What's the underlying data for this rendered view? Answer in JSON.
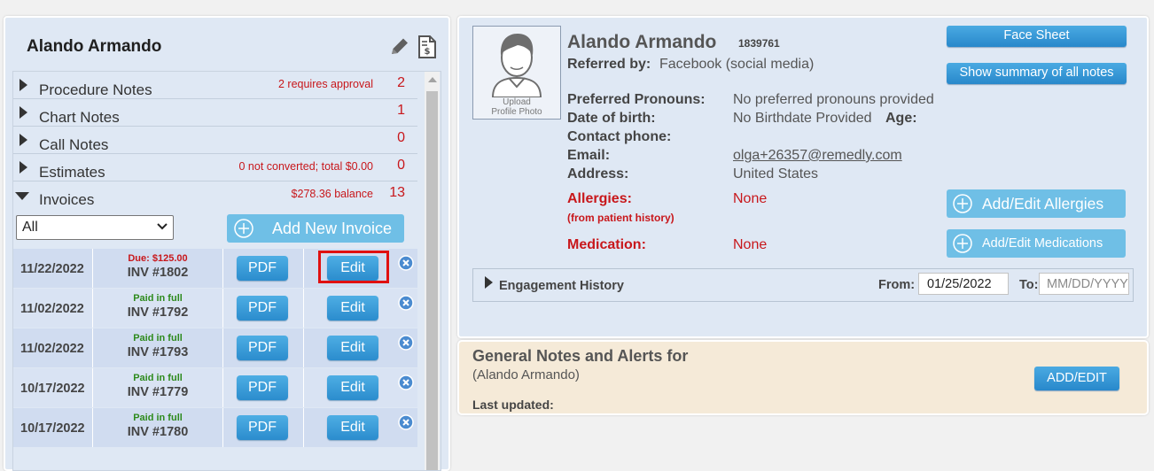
{
  "left": {
    "patient_name": "Alando Armando",
    "sections": [
      {
        "label": "Procedure Notes",
        "note": "2 requires approval",
        "count": "2"
      },
      {
        "label": "Chart Notes",
        "note": "",
        "count": "1"
      },
      {
        "label": "Call Notes",
        "note": "",
        "count": "0"
      },
      {
        "label": "Estimates",
        "note": "0 not converted; total $0.00",
        "count": "0"
      },
      {
        "label": "Invoices",
        "note": "$278.36 balance",
        "count": "13"
      }
    ],
    "filter": {
      "selected": "All"
    },
    "add_invoice_label": "Add New Invoice",
    "invoices": [
      {
        "date": "11/22/2022",
        "status": "Due: $125.00",
        "status_type": "due",
        "number": "INV #1802",
        "pdf_label": "PDF",
        "edit_label": "Edit"
      },
      {
        "date": "11/02/2022",
        "status": "Paid in full",
        "status_type": "paid",
        "number": "INV #1792",
        "pdf_label": "PDF",
        "edit_label": "Edit"
      },
      {
        "date": "11/02/2022",
        "status": "Paid in full",
        "status_type": "paid",
        "number": "INV #1793",
        "pdf_label": "PDF",
        "edit_label": "Edit"
      },
      {
        "date": "10/17/2022",
        "status": "Paid in full",
        "status_type": "paid",
        "number": "INV #1779",
        "pdf_label": "PDF",
        "edit_label": "Edit"
      },
      {
        "date": "10/17/2022",
        "status": "Paid in full",
        "status_type": "paid",
        "number": "INV #1780",
        "pdf_label": "PDF",
        "edit_label": "Edit"
      }
    ]
  },
  "profile": {
    "photo_caption_1": "Upload",
    "photo_caption_2": "Profile Photo",
    "name": "Alando Armando",
    "id": "1839761",
    "referred_label": "Referred by:",
    "referred_value": "Facebook (social media)",
    "pronouns_label": "Preferred Pronouns:",
    "pronouns_value": "No preferred pronouns provided",
    "dob_label": "Date of birth:",
    "dob_value": "No Birthdate Provided",
    "age_label": "Age:",
    "phone_label": "Contact phone:",
    "email_label": "Email:",
    "email_value": "olga+26357@remedly.com",
    "address_label": "Address:",
    "address_value": "United States",
    "allergies_label": "Allergies:",
    "allergies_sub": "(from patient history)",
    "allergies_value": "None",
    "medication_label": "Medication:",
    "medication_value": "None",
    "face_sheet_label": "Face Sheet",
    "summary_label": "Show summary of all notes",
    "add_allergies_label": "Add/Edit Allergies",
    "add_medications_label": "Add/Edit Medications",
    "engagement_label": "Engagement History",
    "from_label": "From:",
    "from_value": "01/25/2022",
    "to_label": "To:",
    "to_placeholder": "MM/DD/YYYY"
  },
  "notes": {
    "title": "General Notes and Alerts for",
    "subtitle": "(Alando Armando)",
    "last_updated_label": "Last updated:",
    "add_edit_label": "ADD/EDIT"
  },
  "colors": {
    "accent_blue": "#2b8ccd",
    "alert_red": "#c8171b",
    "paid_green": "#2d8a1c",
    "highlight": "#e01010"
  }
}
